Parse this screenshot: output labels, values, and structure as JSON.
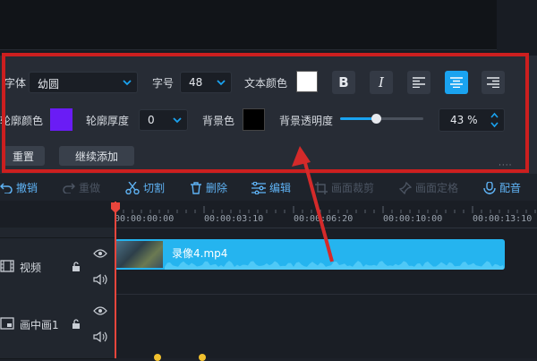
{
  "text_props": {
    "font_label": "字体",
    "font_value": "幼圆",
    "size_label": "字号",
    "size_value": "48",
    "text_color_label": "文本颜色",
    "text_color": "#ffffff",
    "outline_color_label": "轮廓颜色",
    "outline_color": "#6a1cf5",
    "outline_thickness_label": "轮廓厚度",
    "outline_thickness_value": "0",
    "bg_color_label": "背景色",
    "bg_color": "#000000",
    "bg_opacity_label": "背景透明度",
    "bg_opacity_value": "43 %",
    "bg_opacity_fraction": 0.43,
    "bold_glyph": "B",
    "italic_glyph": "I",
    "align_selected": "center",
    "reset_label": "重置",
    "continue_add_label": "继续添加",
    "more_dots": "····"
  },
  "toolbar": {
    "undo": "撤销",
    "redo": "重做",
    "cut": "切割",
    "delete": "删除",
    "edit": "编辑",
    "crop": "画面裁剪",
    "freeze": "画面定格",
    "dub": "配音"
  },
  "timeline": {
    "ticks": [
      "00:00:00:00",
      "00:00:03:10",
      "00:00:06:20",
      "00:00:10:00",
      "00:00:13:10"
    ],
    "tracks": [
      {
        "name": "视频",
        "icon": "film-icon"
      },
      {
        "name": "画中画1",
        "icon": "pip-icon"
      }
    ],
    "clip_name": "录像4.mp4"
  },
  "colors": {
    "accent": "#1aa3f0",
    "clip": "#25b4ef",
    "highlight": "#cc1f1f",
    "playhead": "#e8453c"
  }
}
